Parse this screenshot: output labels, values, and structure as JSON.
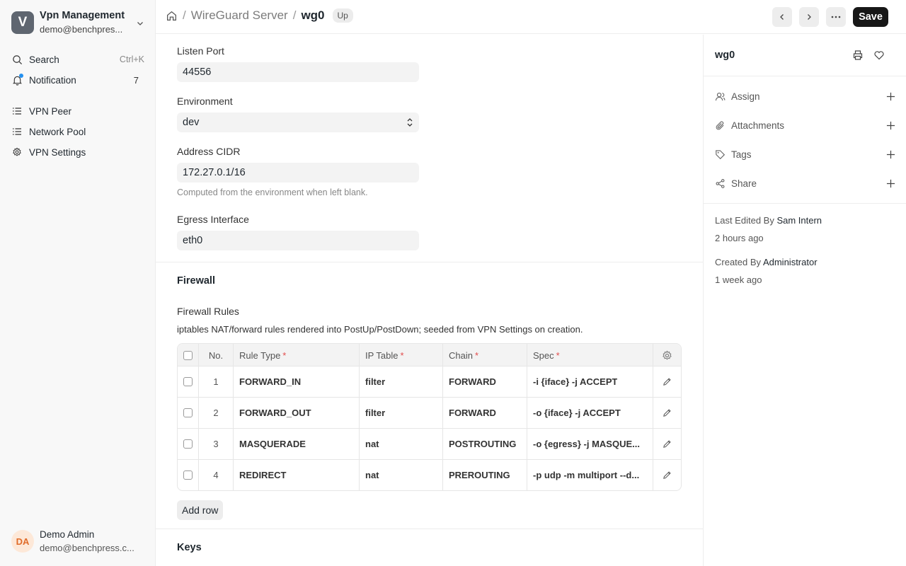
{
  "sidebar": {
    "app_initial": "V",
    "app_name": "Vpn Management",
    "app_email": "demo@benchpres...",
    "search_label": "Search",
    "search_shortcut": "Ctrl+K",
    "notification_label": "Notification",
    "notification_count": "7",
    "items": [
      {
        "label": "VPN Peer",
        "icon": "list-icon"
      },
      {
        "label": "Network Pool",
        "icon": "list-icon"
      },
      {
        "label": "VPN Settings",
        "icon": "gear-icon"
      }
    ],
    "user_initials": "DA",
    "user_name": "Demo Admin",
    "user_email": "demo@benchpress.c..."
  },
  "header": {
    "breadcrumb_parent": "WireGuard Server",
    "breadcrumb_current": "wg0",
    "status_badge": "Up",
    "save_label": "Save"
  },
  "form": {
    "listen_port_label": "Listen Port",
    "listen_port_value": "44556",
    "environment_label": "Environment",
    "environment_value": "dev",
    "address_cidr_label": "Address CIDR",
    "address_cidr_value": "172.27.0.1/16",
    "address_cidr_hint": "Computed from the environment when left blank.",
    "egress_label": "Egress Interface",
    "egress_value": "eth0",
    "firewall_section": "Firewall",
    "firewall_rules_label": "Firewall Rules",
    "firewall_rules_desc": "iptables NAT/forward rules rendered into PostUp/PostDown; seeded from VPN Settings on creation.",
    "add_row_label": "Add row",
    "keys_section": "Keys"
  },
  "table": {
    "columns": {
      "no": "No.",
      "rule_type": "Rule Type",
      "ip_table": "IP Table",
      "chain": "Chain",
      "spec": "Spec"
    },
    "rows": [
      {
        "no": "1",
        "rule_type": "FORWARD_IN",
        "ip_table": "filter",
        "chain": "FORWARD",
        "spec": "-i {iface} -j ACCEPT"
      },
      {
        "no": "2",
        "rule_type": "FORWARD_OUT",
        "ip_table": "filter",
        "chain": "FORWARD",
        "spec": "-o {iface} -j ACCEPT"
      },
      {
        "no": "3",
        "rule_type": "MASQUERADE",
        "ip_table": "nat",
        "chain": "POSTROUTING",
        "spec": "-o {egress} -j MASQUE..."
      },
      {
        "no": "4",
        "rule_type": "REDIRECT",
        "ip_table": "nat",
        "chain": "PREROUTING",
        "spec": "-p udp -m multiport --d..."
      }
    ]
  },
  "right_panel": {
    "title": "wg0",
    "assign": "Assign",
    "attachments": "Attachments",
    "tags": "Tags",
    "share": "Share",
    "last_edited_prefix": "Last Edited By",
    "last_edited_by": "Sam Intern",
    "last_edited_time": "2 hours ago",
    "created_prefix": "Created By",
    "created_by": "Administrator",
    "created_time": "1 week ago"
  },
  "colors": {
    "primary_button": "#171717",
    "notification_dot": "#2490ef",
    "required": "#e24c4c"
  }
}
